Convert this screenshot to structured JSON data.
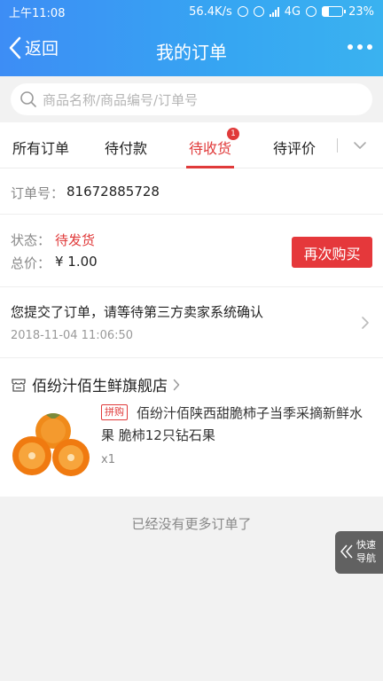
{
  "status_bar": {
    "time": "上午11:08",
    "net_speed": "56.4K/s",
    "network": "4G",
    "battery": "23%"
  },
  "nav": {
    "back_label": "返回",
    "title": "我的订单",
    "more_icon": "more-dots-icon"
  },
  "search": {
    "placeholder": "商品名称/商品编号/订单号"
  },
  "tabs": [
    {
      "label": "所有订单",
      "active": false
    },
    {
      "label": "待付款",
      "active": false
    },
    {
      "label": "待收货",
      "active": true,
      "badge": "1"
    },
    {
      "label": "待评价",
      "active": false
    }
  ],
  "order": {
    "number_label": "订单号：",
    "number": "81672885728",
    "status_label": "状态：",
    "status": "待发货",
    "total_label": "总价：",
    "total": "¥ 1.00",
    "rebuy_label": "再次购买",
    "message": "您提交了订单，请等待第三方卖家系统确认",
    "message_time": "2018-11-04 11:06:50",
    "shop_name": "佰纷汁佰生鲜旗舰店",
    "product_tag": "拼购",
    "product_title": "佰纷汁佰陕西甜脆柿子当季采摘新鲜水果 脆柿12只钻石果",
    "quantity": "x1"
  },
  "footer": {
    "no_more": "已经没有更多订单了",
    "quick_nav": "快速导航"
  },
  "colors": {
    "accent": "#e03a3a",
    "header_start": "#3d8df5",
    "header_end": "#3ab2f0"
  }
}
